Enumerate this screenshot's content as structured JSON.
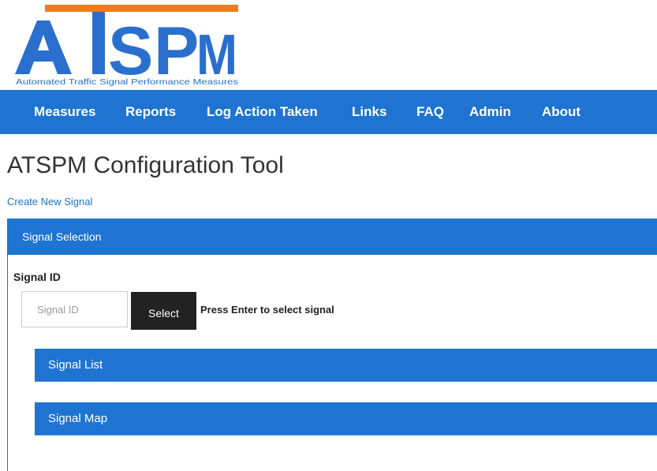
{
  "logo": {
    "letters": "ATSPM",
    "tagline": "Automated Traffic Signal Performance Measures",
    "bar_color": "#f07a1c",
    "letter_color": "#2a6fcd"
  },
  "nav": {
    "items": [
      {
        "label": "Measures"
      },
      {
        "label": "Reports"
      },
      {
        "label": "Log Action Taken"
      },
      {
        "label": "Links"
      },
      {
        "label": "FAQ"
      },
      {
        "label": "Admin"
      },
      {
        "label": "About"
      }
    ]
  },
  "page": {
    "title": "ATSPM Configuration Tool",
    "create_link": "Create New Signal"
  },
  "selection_panel": {
    "header": "Signal Selection",
    "field_label": "Signal ID",
    "input_value": "",
    "input_placeholder": "Signal ID",
    "select_button": "Select",
    "hint": "Press Enter to select signal"
  },
  "sub_panels": {
    "signal_list": "Signal List",
    "signal_map": "Signal Map"
  },
  "colors": {
    "primary_blue": "#1e74d0",
    "button_dark": "#222222",
    "accent_orange": "#f07a1c"
  }
}
